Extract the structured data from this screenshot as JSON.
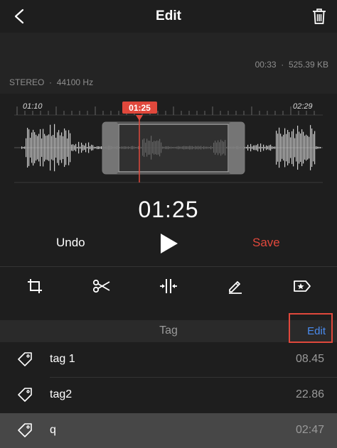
{
  "header": {
    "title": "Edit"
  },
  "file_info": {
    "duration": "00:33",
    "size": "525.39 KB",
    "channels": "STEREO",
    "sample_rate": "44100 Hz"
  },
  "waveform": {
    "start_time": "01:10",
    "end_time": "02:29",
    "playhead_time": "01:25"
  },
  "player": {
    "current_time": "01:25",
    "undo_label": "Undo",
    "save_label": "Save"
  },
  "toolbar": {
    "tools": [
      "crop-icon",
      "scissors-icon",
      "split-icon",
      "pencil-icon",
      "tag-star-icon"
    ]
  },
  "tags_section": {
    "title": "Tag",
    "edit_label": "Edit",
    "items": [
      {
        "name": "tag 1",
        "time": "08.45"
      },
      {
        "name": "tag2",
        "time": "22.86"
      },
      {
        "name": "q",
        "time": "02:47"
      }
    ]
  },
  "colors": {
    "accent_red": "#e0483c",
    "link_blue": "#4a8cf0",
    "background": "#1e1e1e"
  }
}
